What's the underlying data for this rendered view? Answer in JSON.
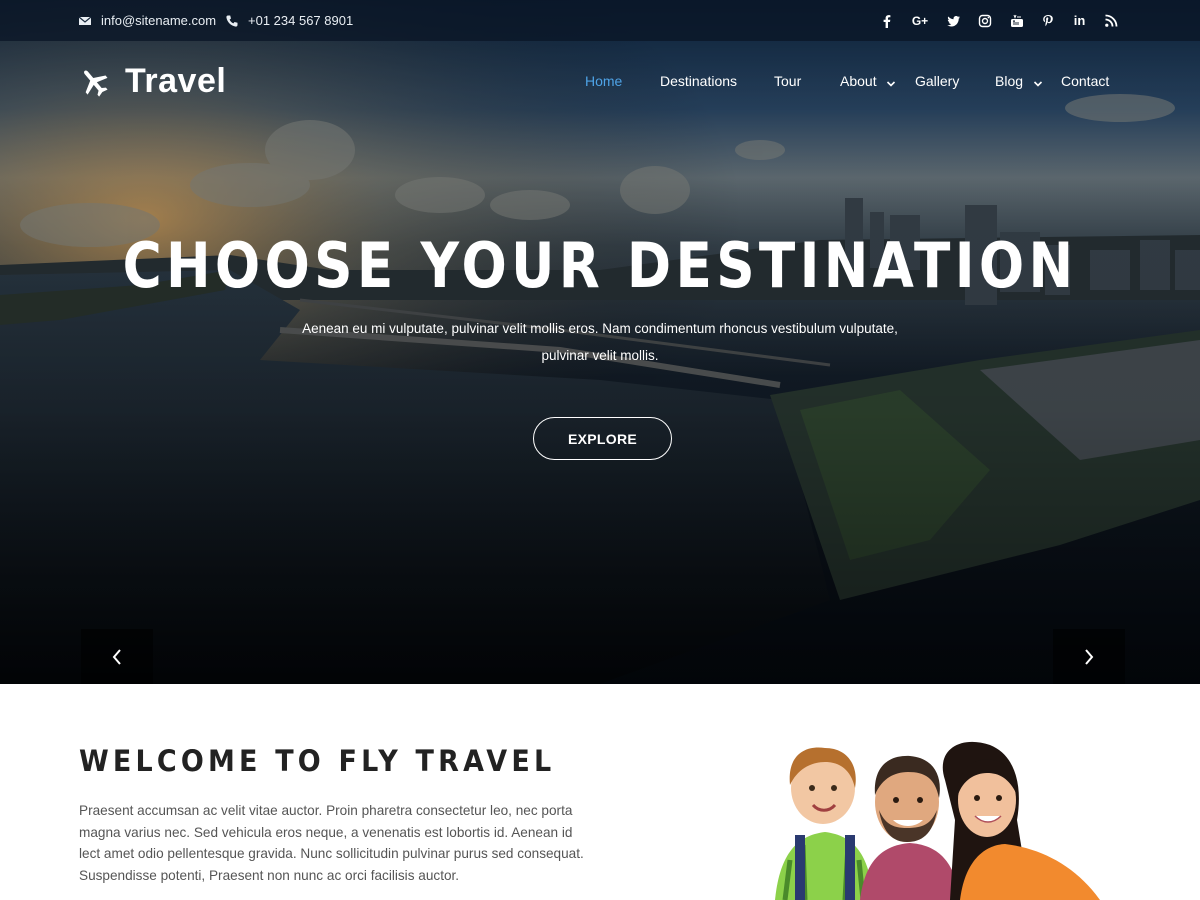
{
  "topbar": {
    "email": "info@sitename.com",
    "phone": "+01 234 567 8901",
    "socials": [
      "facebook-icon",
      "google-plus-icon",
      "twitter-icon",
      "instagram-icon",
      "youtube-icon",
      "pinterest-icon",
      "linkedin-icon",
      "rss-icon"
    ],
    "google_plus_label": "G+",
    "linkedin_label": "in"
  },
  "header": {
    "logo_text": "Travel",
    "nav": [
      {
        "label": "Home",
        "active": true
      },
      {
        "label": "Destinations"
      },
      {
        "label": "Tour"
      },
      {
        "label": "About",
        "has_dropdown": true
      },
      {
        "label": "Gallery"
      },
      {
        "label": "Blog",
        "has_dropdown": true
      },
      {
        "label": "Contact"
      }
    ]
  },
  "hero": {
    "title": "CHOOSE YOUR DESTINATION",
    "subtitle_line1": "Aenean eu mi vulputate, pulvinar velit mollis eros. Nam condimentum rhoncus vestibulum vulputate,",
    "subtitle_line2": "pulvinar velit mollis.",
    "cta_label": "EXPLORE"
  },
  "welcome": {
    "title": "WELCOME TO FLY TRAVEL",
    "text": "Praesent accumsan ac velit vitae auctor. Proin pharetra consectetur leo, nec porta magna varius nec. Sed vehicula eros neque, a venenatis est lobortis id. Aenean id lect amet odio pellentesque gravida. Nunc sollicitudin pulvinar purus sed consequat. Suspendisse potenti, Praesent non nunc ac orci facilisis auctor."
  },
  "colors": {
    "accent": "#4ea3e6",
    "topbar_bg": "#0a1626",
    "heading": "#222222",
    "body_text": "#555555"
  }
}
